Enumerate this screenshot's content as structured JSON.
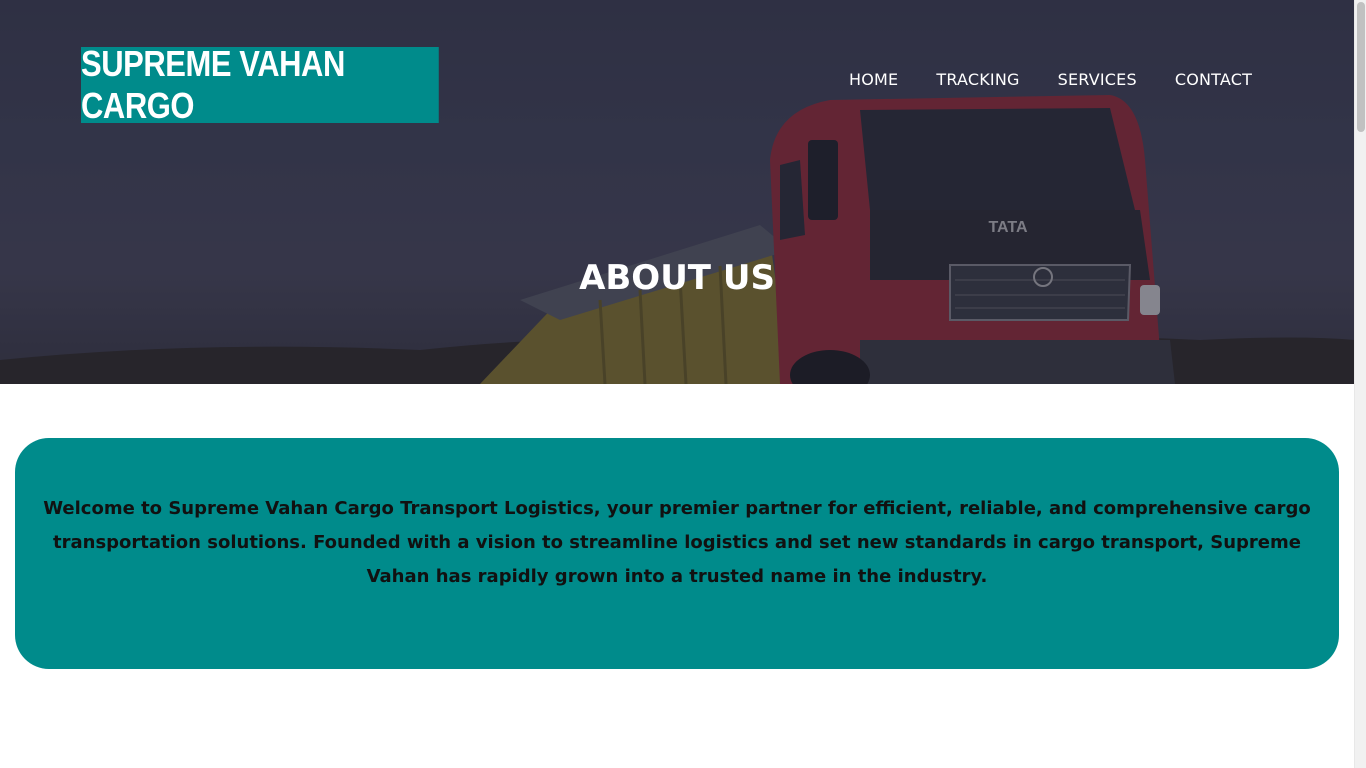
{
  "brand": {
    "name": "SUPREME VAHAN CARGO",
    "color": "#008b8b"
  },
  "nav": {
    "items": [
      {
        "label": "HOME"
      },
      {
        "label": "TRACKING"
      },
      {
        "label": "SERVICES"
      },
      {
        "label": "CONTACT"
      }
    ]
  },
  "hero": {
    "title": "ABOUT US",
    "truck_badge": "TATA"
  },
  "about": {
    "text": "Welcome to Supreme Vahan Cargo Transport Logistics, your premier partner for efficient, reliable, and comprehensive cargo transportation solutions. Founded with a vision to streamline logistics and set new standards in cargo transport, Supreme Vahan has rapidly grown into a trusted name in the industry."
  }
}
